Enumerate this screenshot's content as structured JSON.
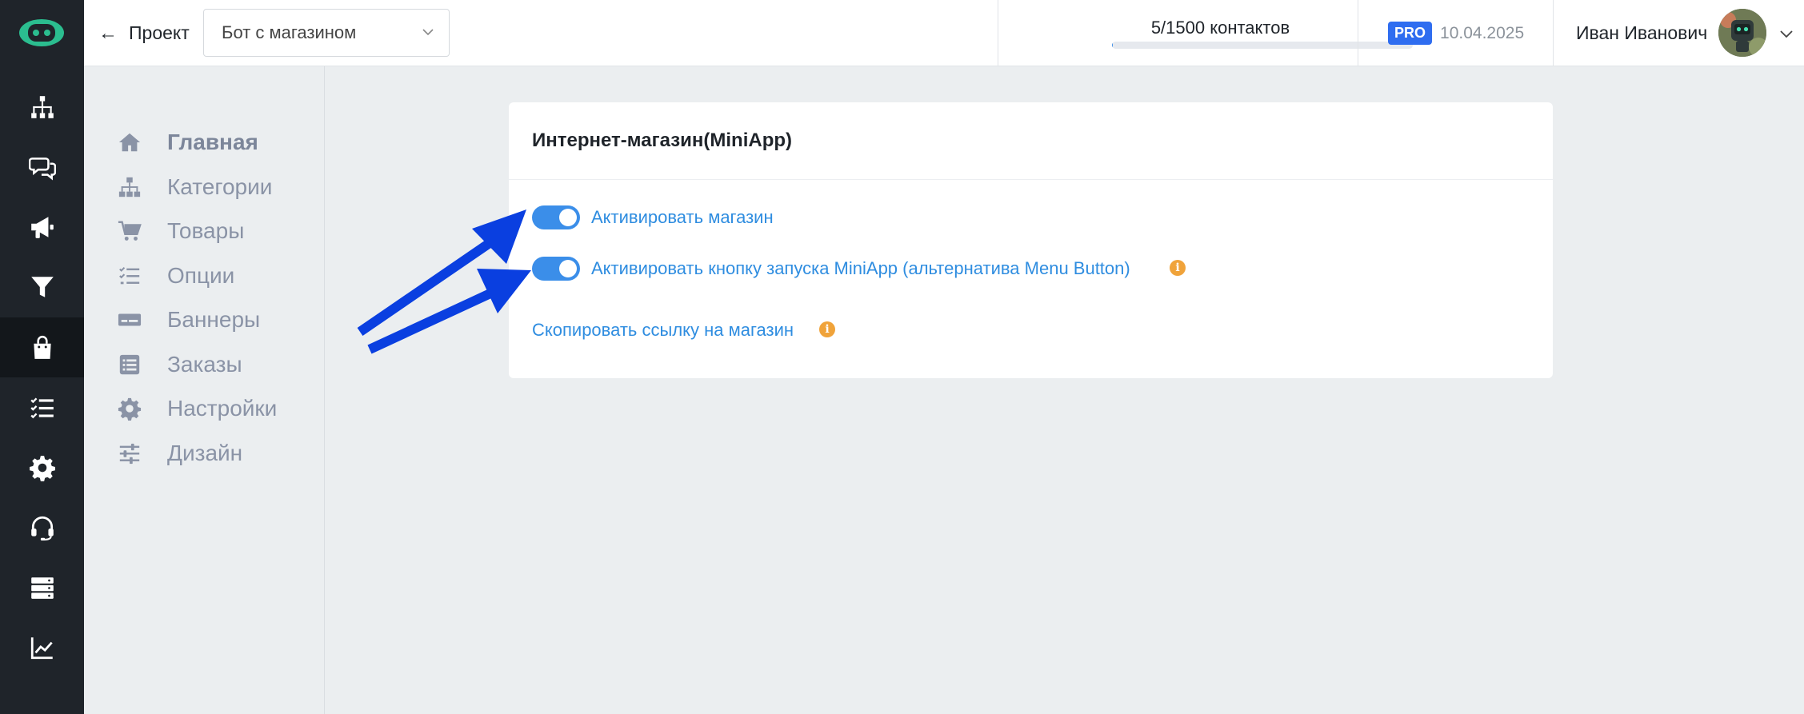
{
  "header": {
    "back_label": "Проект",
    "project_select_value": "Бот с магазином",
    "contacts_text": "5/1500 контактов",
    "contacts_progress": 0.0033,
    "plan_badge": "PRO",
    "plan_date": "10.04.2025",
    "user_name": "Иван Иванович"
  },
  "rail": {
    "items": [
      {
        "icon": "sitemap-icon"
      },
      {
        "icon": "chat-icon"
      },
      {
        "icon": "megaphone-icon"
      },
      {
        "icon": "filter-icon"
      },
      {
        "icon": "shopping-bag-icon",
        "active": true
      },
      {
        "icon": "checklist-icon"
      },
      {
        "icon": "gear-icon"
      },
      {
        "icon": "headset-icon"
      },
      {
        "icon": "server-icon"
      },
      {
        "icon": "chart-icon"
      }
    ]
  },
  "subnav": {
    "items": [
      {
        "label": "Главная",
        "icon": "home-icon",
        "active": true
      },
      {
        "label": "Категории",
        "icon": "sitemap-icon"
      },
      {
        "label": "Товары",
        "icon": "cart-icon"
      },
      {
        "label": "Опции",
        "icon": "checklist-icon"
      },
      {
        "label": "Баннеры",
        "icon": "banner-icon"
      },
      {
        "label": "Заказы",
        "icon": "list-icon"
      },
      {
        "label": "Настройки",
        "icon": "gear-icon"
      },
      {
        "label": "Дизайн",
        "icon": "sliders-icon"
      }
    ]
  },
  "card": {
    "title": "Интернет-магазин(MiniApp)",
    "options": [
      {
        "label": "Активировать магазин",
        "enabled": true
      },
      {
        "label": "Активировать кнопку запуска MiniApp (альтернатива Menu Button)",
        "enabled": true
      }
    ],
    "copy_link_label": "Скопировать ссылку на магазин"
  },
  "colors": {
    "accent": "#3b8ee9",
    "link": "#2f8de0",
    "rail_bg": "#1f242a",
    "info": "#f0a33a",
    "annotation_arrow": "#0a3fe0",
    "pro_badge": "#2f6df0"
  }
}
